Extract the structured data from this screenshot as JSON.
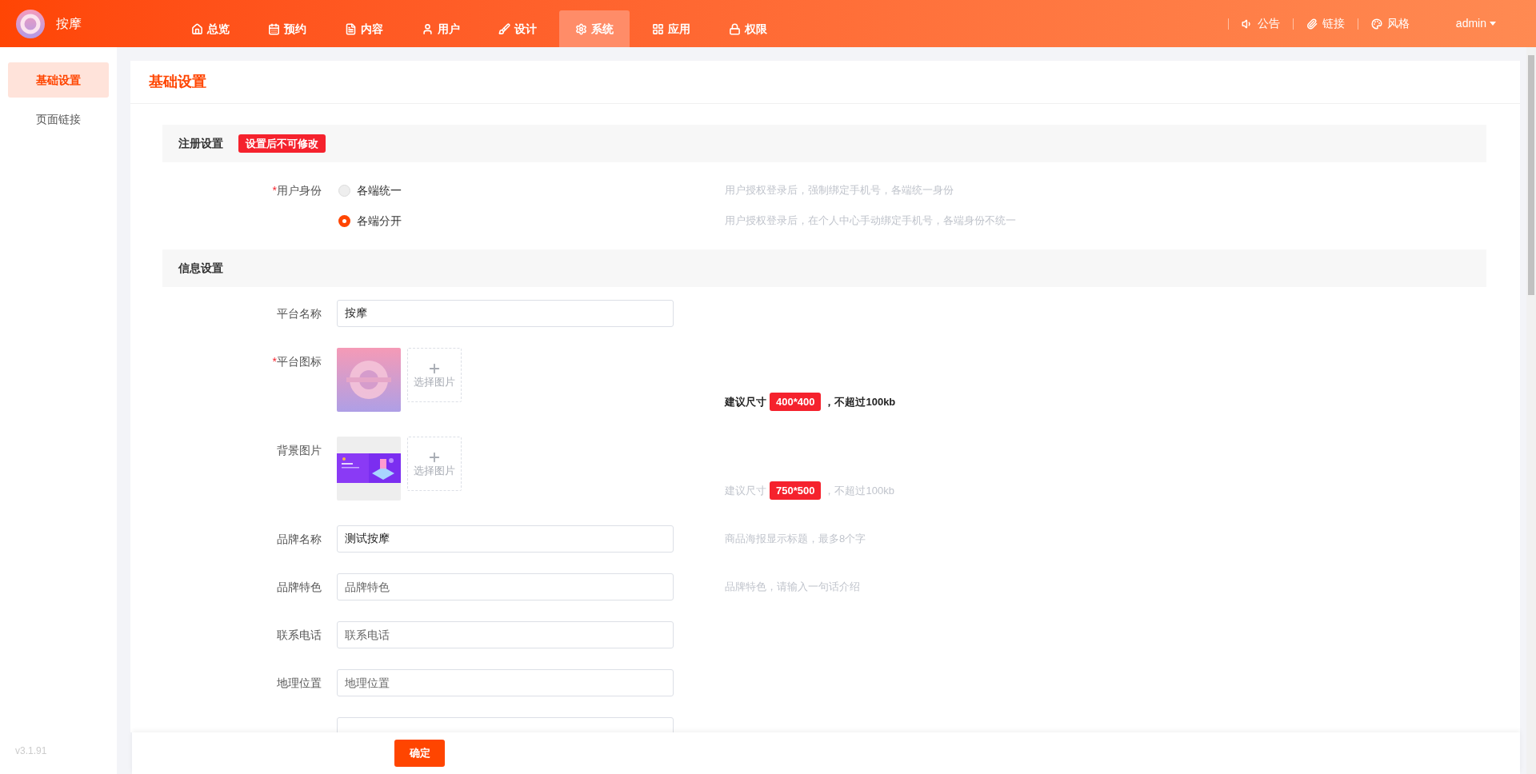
{
  "app": {
    "name": "按摩"
  },
  "nav": [
    {
      "label": "总览",
      "selected": false
    },
    {
      "label": "预约",
      "selected": false
    },
    {
      "label": "内容",
      "selected": false
    },
    {
      "label": "用户",
      "selected": false
    },
    {
      "label": "设计",
      "selected": false
    },
    {
      "label": "系统",
      "selected": true
    },
    {
      "label": "应用",
      "selected": false
    },
    {
      "label": "权限",
      "selected": false
    }
  ],
  "header_actions": [
    {
      "label": "公告"
    },
    {
      "label": "链接"
    },
    {
      "label": "风格"
    }
  ],
  "user": {
    "name": "admin"
  },
  "sidebar": {
    "items": [
      {
        "label": "基础设置",
        "selected": true
      },
      {
        "label": "页面链接",
        "selected": false
      }
    ],
    "version": "v3.1.91"
  },
  "page": {
    "title": "基础设置"
  },
  "sections": [
    {
      "title": "注册设置",
      "badge": "设置后不可修改",
      "rows": [
        {
          "kind": "radio",
          "mark": "*",
          "label": "用户身份",
          "options": [
            {
              "label": "各端统一",
              "selected": false,
              "hint": "用户授权登录后，强制绑定手机号，各端统一身份"
            },
            {
              "label": "各端分开",
              "selected": true,
              "hint": "用户授权登录后，在个人中心手动绑定手机号，各端身份不统一"
            }
          ]
        }
      ]
    },
    {
      "title": "信息设置",
      "rows": [
        {
          "kind": "input",
          "label": "平台名称",
          "value": "按摩"
        },
        {
          "mark": "*",
          "label": "平台图标",
          "add_label": "选择图片",
          "hint": {
            "prefix": "建议尺寸",
            "size": "400*400",
            "suffix": "，不超过100kb",
            "emphasis": true
          }
        },
        {
          "label": "背景图片",
          "add_label": "选择图片",
          "hint": {
            "prefix": "建议尺寸",
            "size": "750*500",
            "suffix": "，不超过100kb",
            "emphasis": false
          }
        },
        {
          "kind": "input",
          "label": "品牌名称",
          "value": "测试按摩",
          "hint": "商品海报显示标题，最多8个字"
        },
        {
          "kind": "input",
          "label": "品牌特色",
          "placeholder": "品牌特色",
          "hint": "品牌特色，请输入一句话介绍"
        },
        {
          "kind": "input",
          "label": "联系电话",
          "placeholder": "联系电话"
        },
        {
          "kind": "input",
          "label": "地理位置",
          "placeholder": "地理位置"
        },
        {
          "kind": "input"
        }
      ]
    }
  ],
  "footer": {
    "button": "确定"
  }
}
